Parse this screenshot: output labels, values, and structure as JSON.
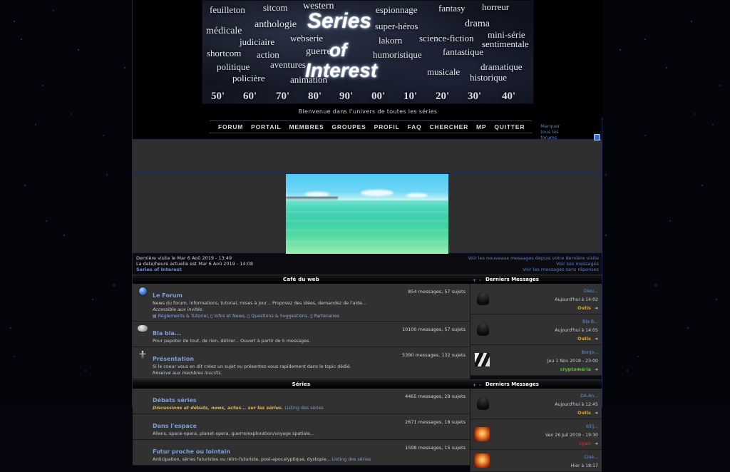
{
  "site": {
    "name": "Series of Interest",
    "tagline": "Bienvenue dans l'univers de toutes les séries"
  },
  "logo": {
    "title_line1": "Series",
    "title_line2": "of",
    "title_line3": "Interest",
    "keywords": [
      "feuilleton",
      "sitcom",
      "western",
      "espionnage",
      "fantasy",
      "horreur",
      "médicale",
      "anthologie",
      "super-héros",
      "drama",
      "judiciaire",
      "webserie",
      "lakorn",
      "science-fiction",
      "mini-série",
      "shortcom",
      "action",
      "guerre",
      "humoristique",
      "fantastique",
      "sentimentale",
      "politique",
      "aventures",
      "musicale",
      "dramatique",
      "policière",
      "animation",
      "historique"
    ],
    "decades": [
      "50'",
      "60'",
      "70'",
      "80'",
      "90'",
      "00'",
      "10'",
      "20'",
      "30'",
      "40'"
    ]
  },
  "nav": {
    "items": [
      {
        "label": "FORUM"
      },
      {
        "label": "PORTAIL"
      },
      {
        "label": "MEMBRES"
      },
      {
        "label": "GROUPES"
      },
      {
        "label": "PROFIL"
      },
      {
        "label": "FAQ"
      },
      {
        "label": "CHERCHER"
      },
      {
        "label": "MP"
      },
      {
        "label": "QUITTER"
      }
    ],
    "mark_read_line1": "Marquer tous les",
    "mark_read_line2": "forums comme lus"
  },
  "status": {
    "last_visit": "Dernière visite le Mar 6 Aoû 2019 - 13:49",
    "current_time": "La date/heure actuelle est Mar 6 Aoû 2019 - 14:08",
    "breadcrumb": "Series of Interest",
    "link_new_messages": "Voir les nouveaux messages depuis votre dernière visite",
    "link_own_messages": "Voir ses messages",
    "link_unanswered": "Voir les messages sans réponses"
  },
  "categories": [
    {
      "title": "Café du web",
      "last_messages_header": "Derniers Messages",
      "pm_toggle": "+ -",
      "forums": [
        {
          "icon": "globe-icon",
          "title": "Le Forum",
          "desc_line1": "News du forum, informations, tutorial, mises à jour... Proposez des idées, demandez de l'aide...",
          "desc_line2": "Accessible aux invités.",
          "subforums": [
            "Règlements & Tutoriel,",
            "Infos et News,",
            "Questions & Suggestions,",
            "Partenaires"
          ],
          "counts": "854 messages, 57 sujets",
          "last": {
            "subject": "Dieu...",
            "date": "Aujourd'hui à 14:02",
            "user": "Outis",
            "user_color": "#e0a81e",
            "avatar": "dark-silhouette-avatar"
          }
        },
        {
          "icon": "speech-bubble-icon",
          "title": "Bla bla...",
          "desc_line1": "Pour papoter de tout, de rien, délirer... Ouvert à partir de 5 messages.",
          "desc_line2": "",
          "subforums": [],
          "counts": "10100 messages, 57 sujets",
          "last": {
            "subject": "Bla B...",
            "date": "Aujourd'hui à 14:05",
            "user": "Outis",
            "user_color": "#e0a81e",
            "avatar": "dark-silhouette-avatar"
          }
        },
        {
          "icon": "podium-icon",
          "title": "Présentation",
          "desc_line1": "Si le coeur vous en dit créez un sujet ou présentez-vous rapidement dans le topic dédié.",
          "desc_line2": "Réservé aux membres inscrits.",
          "subforums": [],
          "counts": "5390 messages, 132 sujets",
          "last": {
            "subject": "Bonjo...",
            "date": "Jeu 1 Nov 2018 - 23:00",
            "user": "cryptoméria",
            "user_color": "#5fbf3a",
            "avatar": "blackwhite-avatar"
          }
        }
      ]
    },
    {
      "title": "Séries",
      "last_messages_header": "Derniers Messages",
      "pm_toggle": "+ -",
      "forums": [
        {
          "icon": "none",
          "title": "Débats séries",
          "desc_line1": "Discussions et débats, news, actus... sur les séries.",
          "desc_link": "Listing des séries",
          "desc_line2": "",
          "subforums": [],
          "counts": "4465 messages, 29 sujets",
          "last": {
            "subject": "DA-An...",
            "date": "Aujourd'hui à 12:45",
            "user": "Outis",
            "user_color": "#e0a81e",
            "avatar": "dark-silhouette-avatar"
          }
        },
        {
          "icon": "none",
          "title": "Dans l'espace",
          "desc_line1": "Aliens, space-opera, planet-opera, guerre/exploration/voyage spatiale...",
          "desc_link": "",
          "desc_line2": "",
          "subforums": [],
          "counts": "2671 messages, 18 sujets",
          "last": {
            "subject": "Killj...",
            "date": "Ven 26 Juil 2019 - 19:30",
            "user": "cyan",
            "user_color": "#cc2222",
            "avatar": "orange-image-avatar"
          }
        },
        {
          "icon": "none",
          "title": "Futur proche ou lointain",
          "desc_line1": "Anticipation, séries futuristes ou rétro-futuriste, post-apocalyptique, dystopie...",
          "desc_link": "Listing des séries",
          "desc_line2": "",
          "subforums": [],
          "counts": "1598 messages, 15 sujets",
          "last": {
            "subject": "Ciné...",
            "date": "Hier à 18:17",
            "user": "",
            "user_color": "#e0a81e",
            "avatar": "orange-image-avatar"
          }
        }
      ]
    }
  ],
  "colors": {
    "page_bg": "#0b0b10",
    "row_bg": "#313131",
    "border_blue": "#1b2a5a",
    "link_blue": "#7e9ed6",
    "accent_gold": "#e0a81e"
  }
}
